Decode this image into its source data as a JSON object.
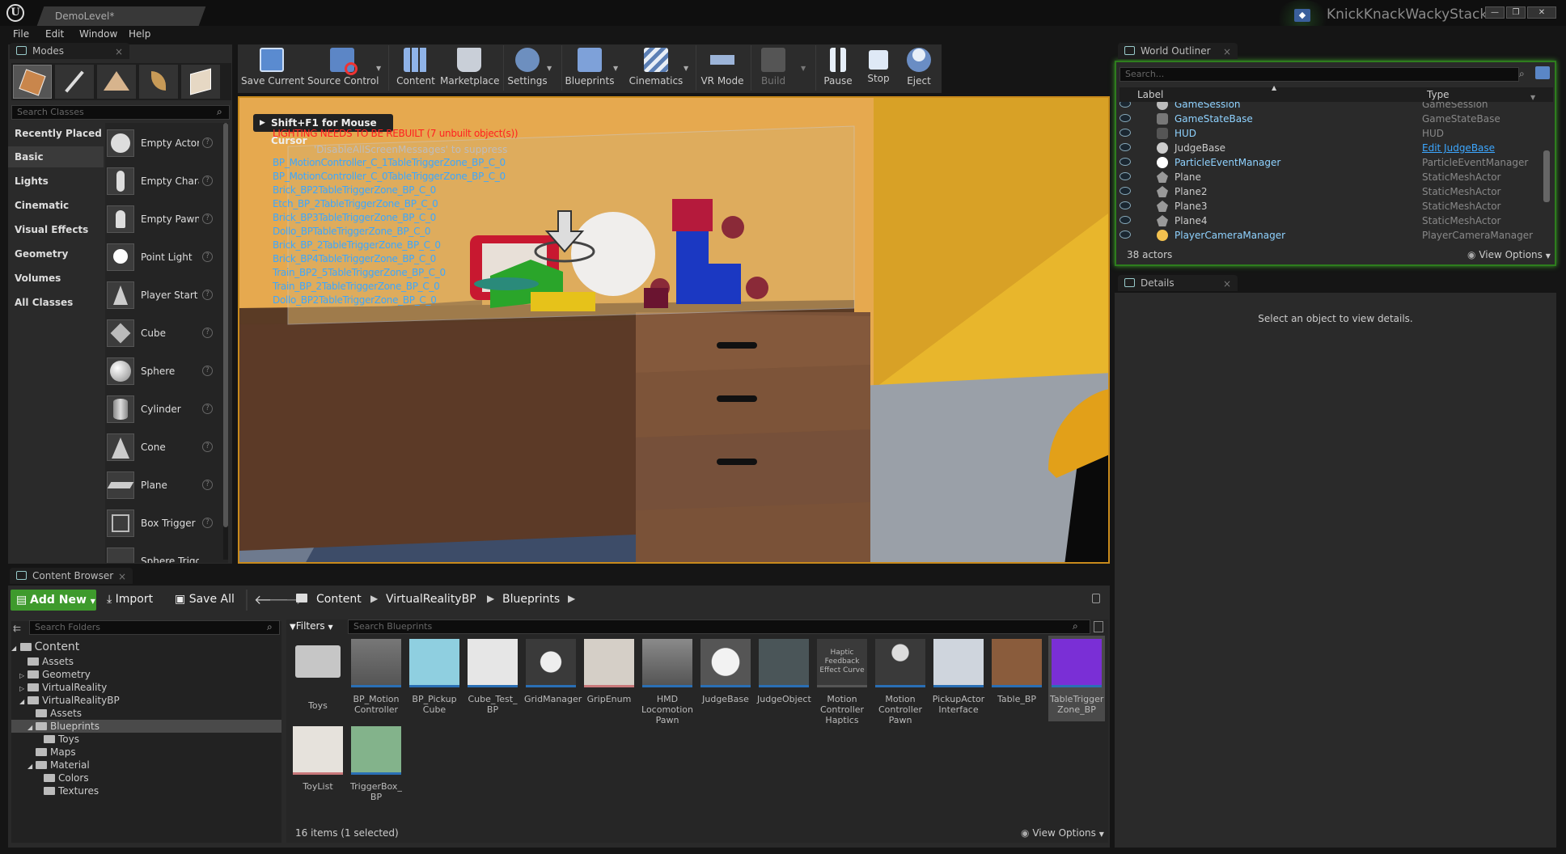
{
  "window": {
    "doc_tab": "DemoLevel*",
    "project_name": "KnickKnackWackyStack",
    "controls": [
      "—",
      "❐",
      "✕"
    ]
  },
  "menu": [
    "File",
    "Edit",
    "Window",
    "Help"
  ],
  "modes": {
    "tab_title": "Modes",
    "search_placeholder": "Search Classes",
    "categories": [
      "Recently Placed",
      "Basic",
      "Lights",
      "Cinematic",
      "Visual Effects",
      "Geometry",
      "Volumes",
      "All Classes"
    ],
    "selected_category": "Basic",
    "items": [
      "Empty Actor",
      "Empty Character",
      "Empty Pawn",
      "Point Light",
      "Player Start",
      "Cube",
      "Sphere",
      "Cylinder",
      "Cone",
      "Plane",
      "Box Trigger",
      "Sphere Trigger"
    ]
  },
  "toolbar": {
    "buttons": [
      "Save Current",
      "Source Control",
      "Content",
      "Marketplace",
      "Settings",
      "Blueprints",
      "Cinematics",
      "VR Mode",
      "Build",
      "Pause",
      "Stop",
      "Eject"
    ]
  },
  "viewport": {
    "hint": "Shift+F1 for Mouse Cursor",
    "warning": "LIGHTING NEEDS TO BE REBUILT (7 unbuilt object(s))",
    "suppress": "'DisableAllScreenMessages' to suppress",
    "messages": [
      "BP_MotionController_C_1TableTriggerZone_BP_C_0",
      "BP_MotionController_C_0TableTriggerZone_BP_C_0",
      "Brick_BP2TableTriggerZone_BP_C_0",
      "Etch_BP_2TableTriggerZone_BP_C_0",
      "Brick_BP3TableTriggerZone_BP_C_0",
      "Dollo_BPTableTriggerZone_BP_C_0",
      "Brick_BP_2TableTriggerZone_BP_C_0",
      "Brick_BP4TableTriggerZone_BP_C_0",
      "Train_BP2_5TableTriggerZone_BP_C_0",
      "Train_BP_2TableTriggerZone_BP_C_0",
      "Dollo_BP2TableTriggerZone_BP_C_0"
    ]
  },
  "outliner": {
    "tab_title": "World Outliner",
    "search_placeholder": "Search...",
    "col_label": "Label",
    "col_type": "Type",
    "rows": [
      {
        "label": "GameSession",
        "type": "GameSession"
      },
      {
        "label": "GameStateBase",
        "type": "GameStateBase"
      },
      {
        "label": "HUD",
        "type": "HUD"
      },
      {
        "label": "JudgeBase",
        "type": "Edit JudgeBase"
      },
      {
        "label": "ParticleEventManager",
        "type": "ParticleEventManager"
      },
      {
        "label": "Plane",
        "type": "StaticMeshActor"
      },
      {
        "label": "Plane2",
        "type": "StaticMeshActor"
      },
      {
        "label": "Plane3",
        "type": "StaticMeshActor"
      },
      {
        "label": "Plane4",
        "type": "StaticMeshActor"
      },
      {
        "label": "PlayerCameraManager",
        "type": "PlayerCameraManager"
      }
    ],
    "count": "38 actors",
    "view_options": "View Options"
  },
  "details": {
    "tab_title": "Details",
    "empty_message": "Select an object to view details."
  },
  "content_browser": {
    "tab_title": "Content Browser",
    "add_new": "Add New",
    "import": "Import",
    "save_all": "Save All",
    "path": [
      "Content",
      "VirtualRealityBP",
      "Blueprints"
    ],
    "search_folders": "Search Folders",
    "filters": "Filters",
    "search_assets": "Search Blueprints",
    "tree": [
      {
        "label": "Content",
        "depth": 0
      },
      {
        "label": "Assets",
        "depth": 1
      },
      {
        "label": "Geometry",
        "depth": 1
      },
      {
        "label": "VirtualReality",
        "depth": 1
      },
      {
        "label": "VirtualRealityBP",
        "depth": 1
      },
      {
        "label": "Assets",
        "depth": 2
      },
      {
        "label": "Blueprints",
        "depth": 2
      },
      {
        "label": "Toys",
        "depth": 3
      },
      {
        "label": "Maps",
        "depth": 2
      },
      {
        "label": "Material",
        "depth": 2
      },
      {
        "label": "Colors",
        "depth": 3
      },
      {
        "label": "Textures",
        "depth": 3
      }
    ],
    "assets": [
      "Toys",
      "BP_Motion Controller",
      "BP_Pickup Cube",
      "Cube_Test_ BP",
      "GridManager",
      "GripEnum",
      "HMD Locomotion Pawn",
      "JudgeBase",
      "JudgeObject",
      "Motion Controller Haptics",
      "Motion Controller Pawn",
      "PickupActor Interface",
      "Table_BP",
      "TableTrigger Zone_BP",
      "ToyList",
      "TriggerBox_ BP"
    ],
    "haptic_thumb": "Haptic Feedback Effect Curve",
    "status": "16 items (1 selected)",
    "view_options": "View Options"
  },
  "colors": {
    "accent_green": "#3e9a2c",
    "link_blue": "#8fd2ff",
    "warning_red": "#ff2020",
    "debug_blue": "#3ca7ff"
  }
}
